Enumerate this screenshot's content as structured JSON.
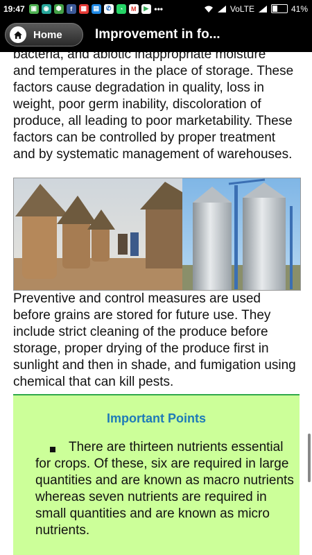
{
  "status_bar": {
    "time": "19:47",
    "network": "VoLTE",
    "battery": "41%",
    "notification_icons": [
      "photo-icon",
      "chat-icon",
      "shield-icon",
      "facebook-icon",
      "grid-icon",
      "app-icon",
      "phone-icon",
      "whatsapp-icon",
      "gmail-icon",
      "play-store-icon",
      "more-icon"
    ]
  },
  "app_bar": {
    "home_label": "Home",
    "title": "Improvement in fo..."
  },
  "content": {
    "paragraph_top_clipped": "bacteria, and abiotic inappropriate moisture",
    "paragraph_top": "and temperatures in the place of storage. These factors cause degradation in quality, loss in weight, poor germ inability, discoloration of produce, all leading to poor marketability. These factors can be controlled by proper treatment and by systematic management of warehouses.",
    "paragraph_middle": "Preventive and control measures are used before grains are stored for future use. They include strict cleaning of the produce before storage, proper drying of the produce first in sunlight and then in shade, and fumigation using chemical that can kill pests."
  },
  "important": {
    "heading": "Important Points",
    "point_1": "There are thirteen nutrients essential for crops. Of these, six are required in large quantities and are known as macro nutrients whereas seven nutrients are required in small quantities and are known as micro nutrients."
  },
  "colors": {
    "app_bar_bg": "#000000",
    "important_bg": "#ccff99",
    "important_border": "#2ea84a",
    "important_heading": "#1e7ab8"
  }
}
